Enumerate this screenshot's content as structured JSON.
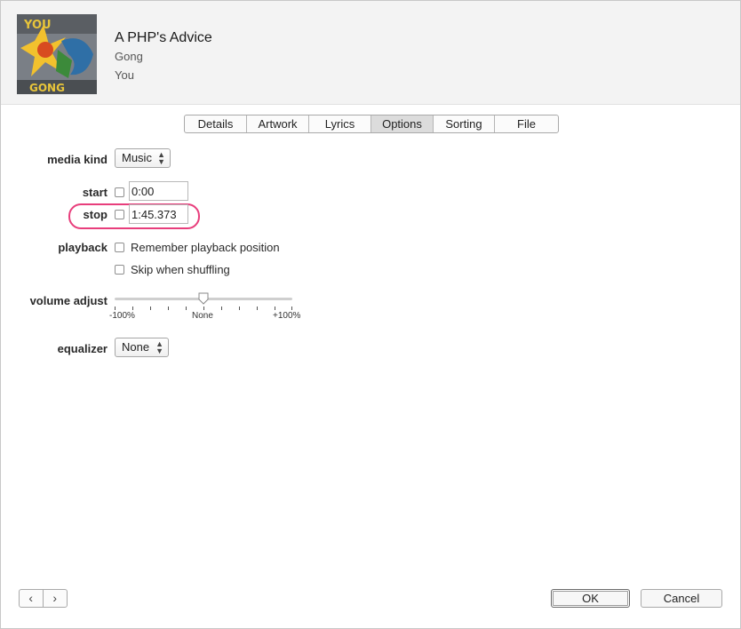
{
  "track": {
    "title": "A PHP's Advice",
    "artist": "Gong",
    "album": "You",
    "artwork_text_top": "YOU",
    "artwork_text_bottom": "GONG"
  },
  "tabs": [
    {
      "label": "Details",
      "active": false
    },
    {
      "label": "Artwork",
      "active": false
    },
    {
      "label": "Lyrics",
      "active": false
    },
    {
      "label": "Options",
      "active": true
    },
    {
      "label": "Sorting",
      "active": false
    },
    {
      "label": "File",
      "active": false
    }
  ],
  "options": {
    "media_kind": {
      "label": "media kind",
      "value": "Music"
    },
    "start": {
      "label": "start",
      "checked": false,
      "value": "0:00"
    },
    "stop": {
      "label": "stop",
      "checked": false,
      "value": "1:45.373"
    },
    "playback": {
      "label": "playback",
      "remember_position": {
        "label": "Remember playback position",
        "checked": false
      },
      "skip_shuffling": {
        "label": "Skip when shuffling",
        "checked": false
      }
    },
    "volume_adjust": {
      "label": "volume adjust",
      "value_percent": 0,
      "min_label": "-100%",
      "mid_label": "None",
      "max_label": "+100%"
    },
    "equalizer": {
      "label": "equalizer",
      "value": "None"
    }
  },
  "footer": {
    "prev_icon": "chevron-left-icon",
    "next_icon": "chevron-right-icon",
    "prev_glyph": "‹",
    "next_glyph": "›",
    "ok_label": "OK",
    "cancel_label": "Cancel"
  },
  "colors": {
    "highlight_annotation": "#e83e7c"
  }
}
